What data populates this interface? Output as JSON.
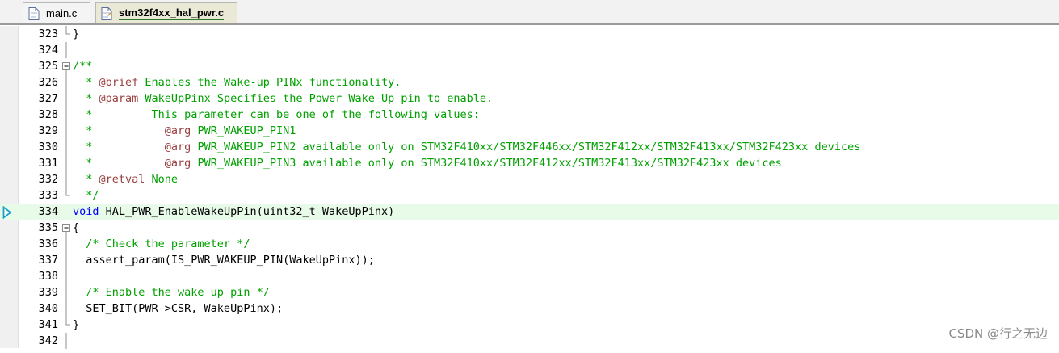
{
  "colors": {
    "comment": "#00a000",
    "tag": "#9a4040",
    "keyword": "#0000ff",
    "plain": "#000000",
    "current_line": "#e8fbe8"
  },
  "tabs": [
    {
      "label": "main.c",
      "icon": "c-file-icon",
      "active": false
    },
    {
      "label": "stm32f4xx_hal_pwr.c",
      "icon": "c-file-icon",
      "active": true
    }
  ],
  "editor": {
    "lines": [
      {
        "num": "323",
        "fold": "end",
        "current": false,
        "tokens": [
          {
            "t": "}",
            "c": "plain"
          }
        ]
      },
      {
        "num": "324",
        "fold": "line",
        "current": false,
        "tokens": []
      },
      {
        "num": "325",
        "fold": "start",
        "current": false,
        "tokens": [
          {
            "t": "/**",
            "c": "comment"
          }
        ]
      },
      {
        "num": "326",
        "fold": "line",
        "current": false,
        "tokens": [
          {
            "t": "  * ",
            "c": "comment"
          },
          {
            "t": "@brief",
            "c": "tag"
          },
          {
            "t": " Enables the Wake-up PINx functionality.",
            "c": "comment"
          }
        ]
      },
      {
        "num": "327",
        "fold": "line",
        "current": false,
        "tokens": [
          {
            "t": "  * ",
            "c": "comment"
          },
          {
            "t": "@param",
            "c": "tag"
          },
          {
            "t": " WakeUpPinx Specifies the Power Wake-Up pin to enable.",
            "c": "comment"
          }
        ]
      },
      {
        "num": "328",
        "fold": "line",
        "current": false,
        "tokens": [
          {
            "t": "  *         This parameter can be one of the following values:",
            "c": "comment"
          }
        ]
      },
      {
        "num": "329",
        "fold": "line",
        "current": false,
        "tokens": [
          {
            "t": "  *           ",
            "c": "comment"
          },
          {
            "t": "@arg",
            "c": "tag"
          },
          {
            "t": " PWR_WAKEUP_PIN1",
            "c": "comment"
          }
        ]
      },
      {
        "num": "330",
        "fold": "line",
        "current": false,
        "tokens": [
          {
            "t": "  *           ",
            "c": "comment"
          },
          {
            "t": "@arg",
            "c": "tag"
          },
          {
            "t": " PWR_WAKEUP_PIN2 available only on STM32F410xx/STM32F446xx/STM32F412xx/STM32F413xx/STM32F423xx devices",
            "c": "comment"
          }
        ]
      },
      {
        "num": "331",
        "fold": "line",
        "current": false,
        "tokens": [
          {
            "t": "  *           ",
            "c": "comment"
          },
          {
            "t": "@arg",
            "c": "tag"
          },
          {
            "t": " PWR_WAKEUP_PIN3 available only on STM32F410xx/STM32F412xx/STM32F413xx/STM32F423xx devices",
            "c": "comment"
          }
        ]
      },
      {
        "num": "332",
        "fold": "line",
        "current": false,
        "tokens": [
          {
            "t": "  * ",
            "c": "comment"
          },
          {
            "t": "@retval",
            "c": "tag"
          },
          {
            "t": " None",
            "c": "comment"
          }
        ]
      },
      {
        "num": "333",
        "fold": "end",
        "current": false,
        "tokens": [
          {
            "t": "  */",
            "c": "comment"
          }
        ]
      },
      {
        "num": "334",
        "fold": "none",
        "current": true,
        "tokens": [
          {
            "t": "void",
            "c": "keyword"
          },
          {
            "t": " HAL_PWR_EnableWakeUpPin(uint32_t WakeUpPinx)",
            "c": "plain"
          }
        ]
      },
      {
        "num": "335",
        "fold": "start",
        "current": false,
        "tokens": [
          {
            "t": "{",
            "c": "plain"
          }
        ]
      },
      {
        "num": "336",
        "fold": "line",
        "current": false,
        "tokens": [
          {
            "t": "  /* Check the parameter */",
            "c": "comment"
          }
        ]
      },
      {
        "num": "337",
        "fold": "line",
        "current": false,
        "tokens": [
          {
            "t": "  assert_param(IS_PWR_WAKEUP_PIN(WakeUpPinx));",
            "c": "plain"
          }
        ]
      },
      {
        "num": "338",
        "fold": "line",
        "current": false,
        "tokens": []
      },
      {
        "num": "339",
        "fold": "line",
        "current": false,
        "tokens": [
          {
            "t": "  /* Enable the wake up pin */",
            "c": "comment"
          }
        ]
      },
      {
        "num": "340",
        "fold": "line",
        "current": false,
        "tokens": [
          {
            "t": "  SET_BIT(PWR->CSR, WakeUpPinx);",
            "c": "plain"
          }
        ]
      },
      {
        "num": "341",
        "fold": "end",
        "current": false,
        "tokens": [
          {
            "t": "}",
            "c": "plain"
          }
        ]
      },
      {
        "num": "342",
        "fold": "line",
        "current": false,
        "tokens": []
      }
    ]
  },
  "watermark": "CSDN @行之无边"
}
